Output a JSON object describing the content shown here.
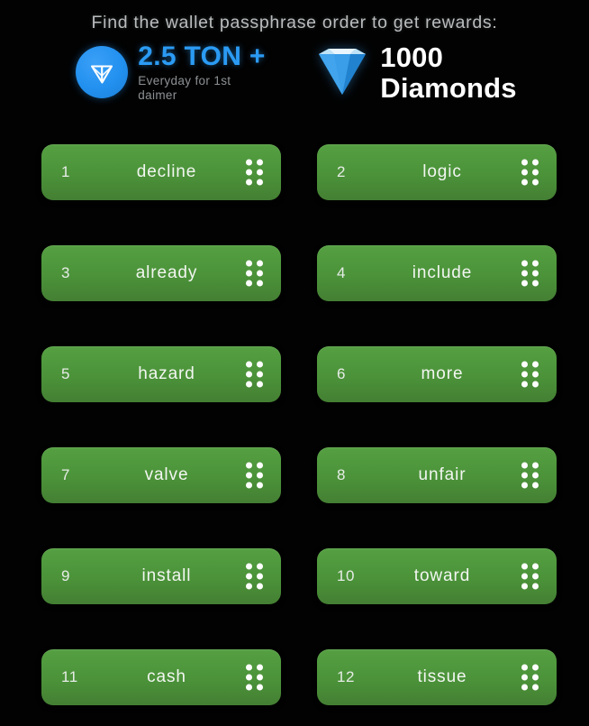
{
  "header": {
    "headline": "Find the wallet passphrase order to get rewards:",
    "rewards": [
      {
        "icon": "ton-coin-icon",
        "amount": "2.5 TON +",
        "subtitle": "Everyday for 1st daimer"
      },
      {
        "icon": "diamond-gem-icon",
        "amount": "1000",
        "unit": "Diamonds"
      }
    ]
  },
  "colors": {
    "background": "#000000",
    "card_green": "#4b9239",
    "ton_blue": "#2b9bf4",
    "headline_gray": "#b9bcbd",
    "subtitle_gray": "#8d9194",
    "handle_white": "#ffffff"
  },
  "words": [
    {
      "index": "1",
      "word": "decline"
    },
    {
      "index": "2",
      "word": "logic"
    },
    {
      "index": "3",
      "word": "already"
    },
    {
      "index": "4",
      "word": "include"
    },
    {
      "index": "5",
      "word": "hazard"
    },
    {
      "index": "6",
      "word": "more"
    },
    {
      "index": "7",
      "word": "valve"
    },
    {
      "index": "8",
      "word": "unfair"
    },
    {
      "index": "9",
      "word": "install"
    },
    {
      "index": "10",
      "word": "toward"
    },
    {
      "index": "11",
      "word": "cash"
    },
    {
      "index": "12",
      "word": "tissue"
    }
  ]
}
